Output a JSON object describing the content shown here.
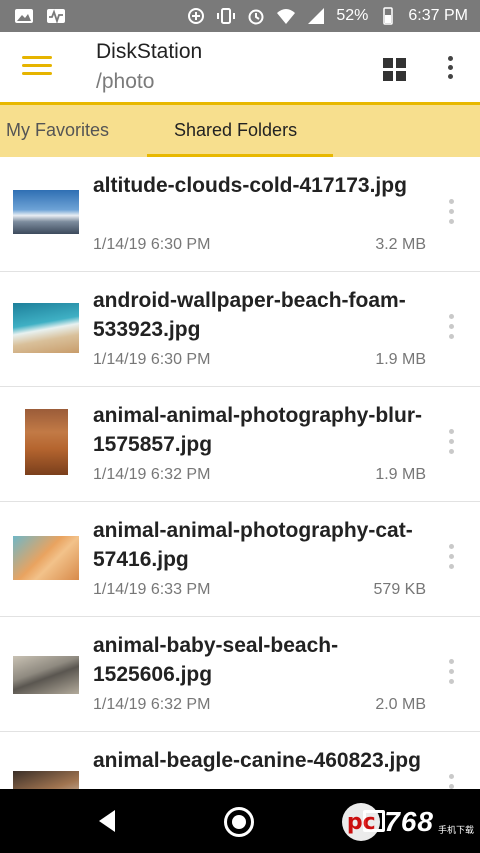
{
  "status_bar": {
    "battery": "52%",
    "time": "6:37 PM",
    "left_icons": [
      "image-icon",
      "pulse-icon"
    ],
    "right_icons": [
      "data-saver-icon",
      "vibrate-icon",
      "alarm-icon",
      "wifi-icon",
      "signal-icon",
      "battery-icon"
    ]
  },
  "app_bar": {
    "title": "DiskStation",
    "subtitle": "/photo",
    "accent": "#e6b400"
  },
  "tabs": [
    {
      "label": "My Favorites",
      "active": false
    },
    {
      "label": "Shared Folders",
      "active": true
    }
  ],
  "files": [
    {
      "name": "altitude-clouds-cold-417173.jpg",
      "date": "1/14/19 6:30 PM",
      "size": "3.2 MB"
    },
    {
      "name": "android-wallpaper-beach-foam-533923.jpg",
      "date": "1/14/19 6:30 PM",
      "size": "1.9 MB"
    },
    {
      "name": "animal-animal-photography-blur-1575857.jpg",
      "date": "1/14/19 6:32 PM",
      "size": "1.9 MB"
    },
    {
      "name": "animal-animal-photography-cat-57416.jpg",
      "date": "1/14/19 6:33 PM",
      "size": "579 KB"
    },
    {
      "name": "animal-baby-seal-beach-1525606.jpg",
      "date": "1/14/19 6:32 PM",
      "size": "2.0 MB"
    },
    {
      "name": "animal-beagle-canine-460823.jpg",
      "date": "",
      "size": ""
    }
  ],
  "watermark": {
    "badge": "pc",
    "text": "768",
    "sub": "手机下载"
  }
}
